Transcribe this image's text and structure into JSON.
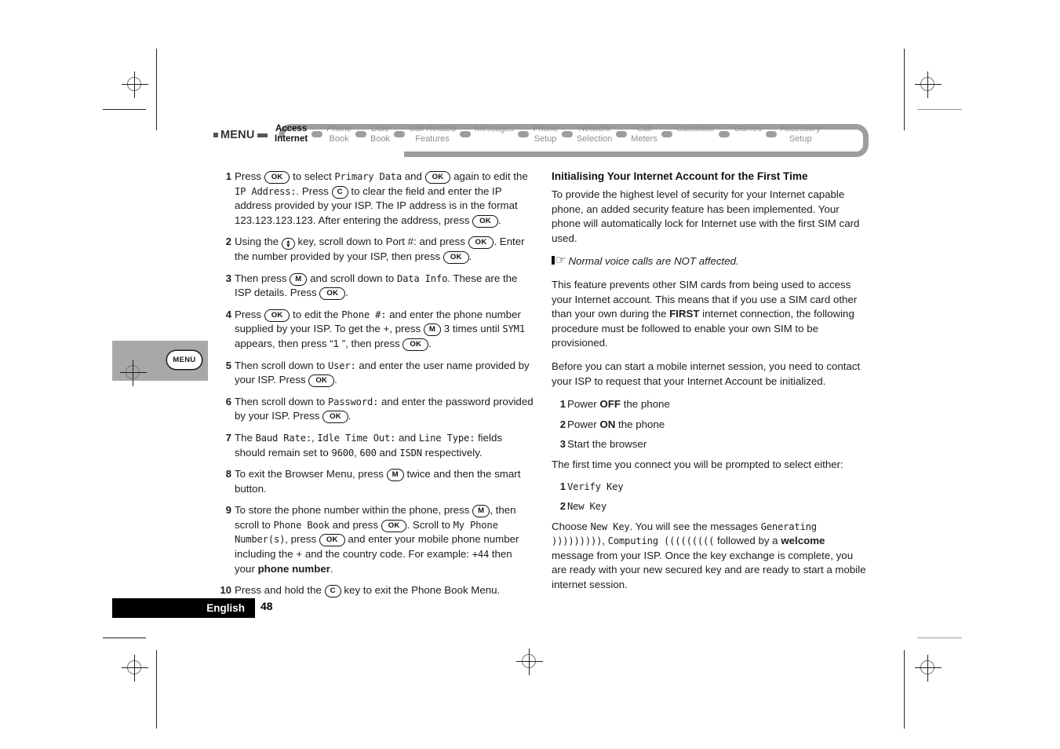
{
  "nav": {
    "menu_label": "MENU",
    "items": [
      {
        "label": "Access\nInternet",
        "active": true
      },
      {
        "label": "Phone\nBook",
        "active": false
      },
      {
        "label": "Date\nBook",
        "active": false
      },
      {
        "label": "Call Related\nFeatures",
        "active": false
      },
      {
        "label": "Messages",
        "active": false
      },
      {
        "label": "Phone\nSetup",
        "active": false
      },
      {
        "label": "Network\nSelection",
        "active": false
      },
      {
        "label": "Call\nMeters",
        "active": false
      },
      {
        "label": "Calculator",
        "active": false
      },
      {
        "label": "Games",
        "active": false
      },
      {
        "label": "Accessory\nSetup",
        "active": false
      }
    ]
  },
  "side_tab": {
    "key_label": "MENU"
  },
  "left_column": {
    "steps": [
      {
        "num": "1",
        "parts": [
          {
            "t": "text",
            "v": "Press "
          },
          {
            "t": "key",
            "v": "OK"
          },
          {
            "t": "text",
            "v": " to select "
          },
          {
            "t": "lcd",
            "v": "Primary Data"
          },
          {
            "t": "text",
            "v": " and "
          },
          {
            "t": "key",
            "v": "OK"
          },
          {
            "t": "text",
            "v": " again to edit the "
          },
          {
            "t": "lcd",
            "v": "IP Address:"
          },
          {
            "t": "text",
            "v": ". Press "
          },
          {
            "t": "key",
            "v": "C"
          },
          {
            "t": "text",
            "v": " to clear the field and enter the IP address provided by your ISP. The IP address is in the format 123.123.123.123. After entering the address, press "
          },
          {
            "t": "key",
            "v": "OK"
          },
          {
            "t": "text",
            "v": "."
          }
        ]
      },
      {
        "num": "2",
        "parts": [
          {
            "t": "text",
            "v": "Using the "
          },
          {
            "t": "scrollkey",
            "v": "scroll"
          },
          {
            "t": "text",
            "v": " key, scroll down to Port #: and press "
          },
          {
            "t": "key",
            "v": "OK"
          },
          {
            "t": "text",
            "v": ". Enter the number provided by your ISP, then press "
          },
          {
            "t": "key",
            "v": "OK"
          },
          {
            "t": "text",
            "v": "."
          }
        ]
      },
      {
        "num": "3",
        "parts": [
          {
            "t": "text",
            "v": "Then press "
          },
          {
            "t": "key",
            "v": "M"
          },
          {
            "t": "text",
            "v": " and scroll down to "
          },
          {
            "t": "lcd",
            "v": "Data Info"
          },
          {
            "t": "text",
            "v": ". These are the ISP details. Press "
          },
          {
            "t": "key",
            "v": "OK"
          },
          {
            "t": "text",
            "v": "."
          }
        ]
      },
      {
        "num": "4",
        "parts": [
          {
            "t": "text",
            "v": "Press "
          },
          {
            "t": "key",
            "v": "OK"
          },
          {
            "t": "text",
            "v": " to edit the "
          },
          {
            "t": "lcd",
            "v": "Phone #:"
          },
          {
            "t": "text",
            "v": " and enter the phone number supplied by your ISP. To get the +, press "
          },
          {
            "t": "key",
            "v": "M"
          },
          {
            "t": "text",
            "v": " 3 times until "
          },
          {
            "t": "lcd",
            "v": "SYM1"
          },
          {
            "t": "text",
            "v": " appears, then press “1 ”, then press "
          },
          {
            "t": "key",
            "v": "OK"
          },
          {
            "t": "text",
            "v": "."
          }
        ]
      },
      {
        "num": "5",
        "parts": [
          {
            "t": "text",
            "v": "Then scroll down to "
          },
          {
            "t": "lcd",
            "v": "User:"
          },
          {
            "t": "text",
            "v": " and enter the user name provided by your ISP. Press "
          },
          {
            "t": "key",
            "v": "OK"
          },
          {
            "t": "text",
            "v": "."
          }
        ]
      },
      {
        "num": "6",
        "parts": [
          {
            "t": "text",
            "v": "Then scroll down to "
          },
          {
            "t": "lcd",
            "v": "Password:"
          },
          {
            "t": "text",
            "v": "  and enter the password provided by your ISP. Press "
          },
          {
            "t": "key",
            "v": "OK"
          },
          {
            "t": "text",
            "v": "."
          }
        ]
      },
      {
        "num": "7",
        "parts": [
          {
            "t": "text",
            "v": "The "
          },
          {
            "t": "lcd",
            "v": "Baud Rate:"
          },
          {
            "t": "text",
            "v": ", "
          },
          {
            "t": "lcd",
            "v": "Idle Time Out:"
          },
          {
            "t": "text",
            "v": " and "
          },
          {
            "t": "lcd",
            "v": "Line Type:"
          },
          {
            "t": "text",
            "v": " fields should remain set to "
          },
          {
            "t": "lcd",
            "v": "9600"
          },
          {
            "t": "text",
            "v": ", "
          },
          {
            "t": "lcd",
            "v": "600"
          },
          {
            "t": "text",
            "v": " and "
          },
          {
            "t": "lcd",
            "v": "ISDN"
          },
          {
            "t": "text",
            "v": " respectively."
          }
        ]
      },
      {
        "num": "8",
        "parts": [
          {
            "t": "text",
            "v": "To exit the Browser Menu, press "
          },
          {
            "t": "key",
            "v": "M"
          },
          {
            "t": "text",
            "v": " twice and then the smart button."
          }
        ]
      },
      {
        "num": "9",
        "parts": [
          {
            "t": "text",
            "v": "To store the phone number within the phone, press "
          },
          {
            "t": "key",
            "v": "M"
          },
          {
            "t": "text",
            "v": ", then scroll to "
          },
          {
            "t": "lcd",
            "v": "Phone Book"
          },
          {
            "t": "text",
            "v": " and press "
          },
          {
            "t": "key",
            "v": "OK"
          },
          {
            "t": "text",
            "v": ". Scroll to "
          },
          {
            "t": "lcd",
            "v": "My Phone Number(s)"
          },
          {
            "t": "text",
            "v": ", press "
          },
          {
            "t": "key",
            "v": "OK"
          },
          {
            "t": "text",
            "v": " and enter your mobile phone number including the + and the country code. For example: "
          },
          {
            "t": "lcd",
            "v": "+44"
          },
          {
            "t": "text",
            "v": " then your "
          },
          {
            "t": "bold",
            "v": "phone number"
          },
          {
            "t": "text",
            "v": "."
          }
        ]
      },
      {
        "num": "10",
        "parts": [
          {
            "t": "text",
            "v": "Press and hold the "
          },
          {
            "t": "key",
            "v": "C"
          },
          {
            "t": "text",
            "v": " key to exit the Phone Book Menu."
          }
        ]
      }
    ]
  },
  "right_column": {
    "title": "Initialising Your Internet Account for the First Time",
    "para1": "To provide the highest level of security for your Internet capable phone, an added security feature has been implemented. Your phone will automatically lock for Internet use with the first SIM card used.",
    "note": "Normal voice calls are NOT affected.",
    "para2_parts": [
      {
        "t": "text",
        "v": "This feature prevents other SIM cards from being used to access your Internet account. This means that if you use a SIM card other than your own during the "
      },
      {
        "t": "bold",
        "v": "FIRST"
      },
      {
        "t": "text",
        "v": " internet connection, the following procedure must be followed to enable your own SIM to be provisioned."
      }
    ],
    "para3": "Before you can start a mobile internet session, you need to contact your ISP to request that your Internet Account be initialized.",
    "steps_power": [
      {
        "num": "1",
        "parts": [
          {
            "t": "text",
            "v": "Power "
          },
          {
            "t": "bold",
            "v": "OFF"
          },
          {
            "t": "text",
            "v": " the phone"
          }
        ]
      },
      {
        "num": "2",
        "parts": [
          {
            "t": "text",
            "v": "Power "
          },
          {
            "t": "bold",
            "v": "ON"
          },
          {
            "t": "text",
            "v": " the phone"
          }
        ]
      },
      {
        "num": "3",
        "parts": [
          {
            "t": "text",
            "v": "Start the browser"
          }
        ]
      }
    ],
    "para4": "The first time you connect you will be prompted to select either:",
    "steps_key": [
      {
        "num": "1",
        "parts": [
          {
            "t": "lcd",
            "v": "Verify Key"
          }
        ]
      },
      {
        "num": "2",
        "parts": [
          {
            "t": "lcd",
            "v": "New Key"
          }
        ]
      }
    ],
    "para5_parts": [
      {
        "t": "text",
        "v": "Choose "
      },
      {
        "t": "lcd",
        "v": "New Key"
      },
      {
        "t": "text",
        "v": ". You will see the messages "
      },
      {
        "t": "lcd",
        "v": "Generating )))))))))"
      },
      {
        "t": "text",
        "v": ", "
      },
      {
        "t": "lcd",
        "v": "Computing ((((((((("
      },
      {
        "t": "text",
        "v": " followed by a "
      },
      {
        "t": "bold",
        "v": "welcome"
      },
      {
        "t": "text",
        "v": " message from your ISP. Once the key exchange is complete, you are ready with your new secured key and are ready to start a mobile internet session."
      }
    ]
  },
  "footer": {
    "language": "English",
    "page_number": "48"
  }
}
